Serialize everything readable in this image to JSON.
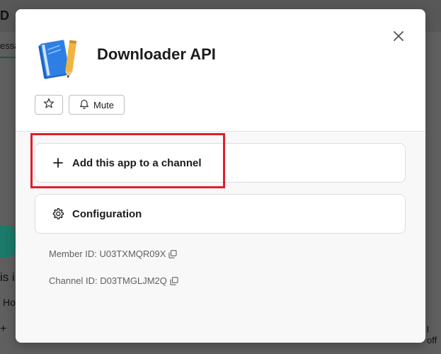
{
  "background": {
    "fragments": [
      "D",
      "essa",
      "is i",
      "Ho",
      "+",
      "l off"
    ]
  },
  "modal": {
    "app_name": "Downloader API",
    "star_label": "",
    "mute_label": "Mute",
    "actions": [
      {
        "label": "Add this app to a channel",
        "icon": "plus-icon"
      },
      {
        "label": "Configuration",
        "icon": "gear-icon"
      }
    ],
    "member_id": "Member ID: U03TXMQR09X",
    "channel_id": "Channel ID: D03TMGLJM2Q"
  },
  "colors": {
    "highlight": "#e01e2a",
    "accent_green": "#1b7a6a"
  }
}
